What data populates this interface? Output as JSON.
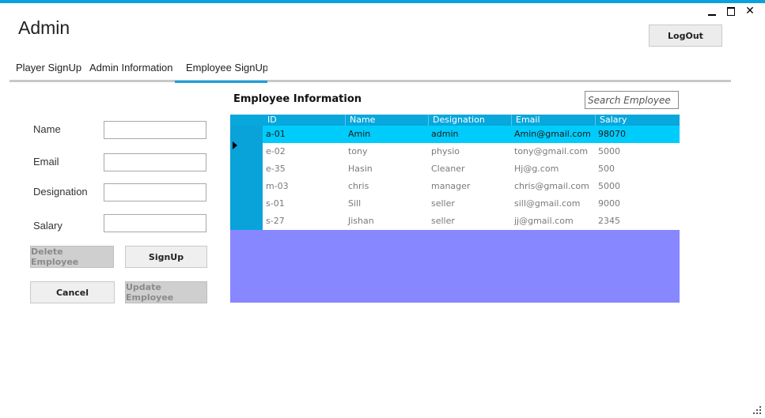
{
  "window": {
    "title": "Admin",
    "minimize_icon": "minimize-icon",
    "maximize_icon": "maximize-icon",
    "close_icon": "close-icon",
    "close_glyph": "✕"
  },
  "header": {
    "logout_label": "LogOut"
  },
  "tabs": [
    {
      "label": "Player SignUp"
    },
    {
      "label": "Admin Information"
    },
    {
      "label": "Employee SignUp"
    }
  ],
  "form": {
    "name_label": "Name",
    "email_label": "Email",
    "designation_label": "Designation",
    "salary_label": "Salary",
    "name_value": "",
    "email_value": "",
    "designation_value": "",
    "salary_value": ""
  },
  "buttons": {
    "delete_employee": "Delete Employee",
    "signup": "SignUp",
    "cancel": "Cancel",
    "update_employee": "Update Employee"
  },
  "table": {
    "title": "Employee Information",
    "search_placeholder": "Search Employee",
    "columns": [
      "ID",
      "Name",
      "Designation",
      "Email",
      "Salary"
    ],
    "rows": [
      [
        "a-01",
        "Amin",
        "admin",
        "Amin@gmail.com",
        "98070"
      ],
      [
        "e-02",
        "tony",
        "physio",
        "tony@gmail.com",
        "5000"
      ],
      [
        "e-35",
        "Hasin",
        "Cleaner",
        "Hj@g.com",
        "500"
      ],
      [
        "m-03",
        "chris",
        "manager",
        "chris@gmail.com",
        "5000"
      ],
      [
        "s-01",
        "Sill",
        "seller",
        "sill@gmail.com",
        "9000"
      ],
      [
        "s-27",
        "Jishan",
        "seller",
        "jj@gmail.com",
        "2345"
      ]
    ],
    "selected_row_index": 0
  },
  "colors": {
    "accent": "#1ba1e2",
    "grid_header": "#08a7dc",
    "selected_row": "#00ccfb",
    "grid_background": "#8787ff"
  }
}
